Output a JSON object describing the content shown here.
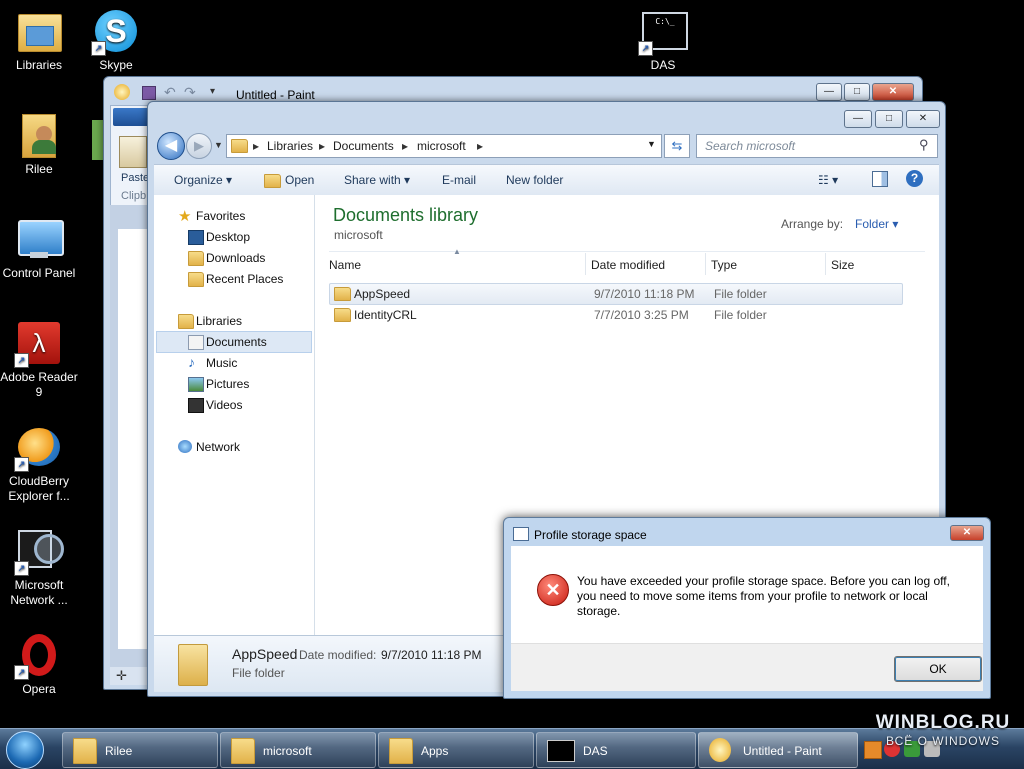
{
  "desktop": {
    "icons": [
      {
        "label": "Libraries"
      },
      {
        "label": "Skype"
      },
      {
        "label": "DAS"
      },
      {
        "label": "Rilee"
      },
      {
        "label": "Control Panel"
      },
      {
        "label": "Adobe Reader 9"
      },
      {
        "label": "CloudBerry Explorer f..."
      },
      {
        "label": "Microsoft Network ..."
      },
      {
        "label": "Opera"
      }
    ]
  },
  "paint": {
    "title": "Untitled - Paint",
    "paste_label": "Paste",
    "clipboard_label": "Clipb"
  },
  "explorer": {
    "breadcrumb": [
      "Libraries",
      "Documents",
      "microsoft"
    ],
    "search_placeholder": "Search microsoft",
    "toolbar": {
      "organize": "Organize",
      "open": "Open",
      "share_with": "Share with",
      "email": "E-mail",
      "new_folder": "New folder"
    },
    "nav": {
      "favorites": "Favorites",
      "desktop": "Desktop",
      "downloads": "Downloads",
      "recent_places": "Recent Places",
      "libraries": "Libraries",
      "documents": "Documents",
      "music": "Music",
      "pictures": "Pictures",
      "videos": "Videos",
      "network": "Network"
    },
    "library_title": "Documents library",
    "library_subtitle": "microsoft",
    "arrange_by_label": "Arrange by:",
    "arrange_by_value": "Folder",
    "columns": {
      "name": "Name",
      "date": "Date modified",
      "type": "Type",
      "size": "Size"
    },
    "files": [
      {
        "name": "AppSpeed",
        "date": "9/7/2010 11:18 PM",
        "type": "File folder"
      },
      {
        "name": "IdentityCRL",
        "date": "7/7/2010 3:25 PM",
        "type": "File folder"
      }
    ],
    "details": {
      "name": "AppSpeed",
      "date_label": "Date modified:",
      "date_value": "9/7/2010 11:18 PM",
      "type": "File folder"
    }
  },
  "dialog": {
    "title": "Profile storage space",
    "message": "You have exceeded your profile storage space. Before you can log off, you need to move some items from your profile to network or local storage.",
    "ok_label": "OK"
  },
  "taskbar": {
    "items": [
      {
        "label": "Rilee"
      },
      {
        "label": "microsoft"
      },
      {
        "label": "Apps"
      },
      {
        "label": "DAS"
      },
      {
        "label": "Untitled - Paint"
      }
    ]
  },
  "watermark": {
    "line1": "WINBLOG.RU",
    "line2": "ВСЁ О WINDOWS"
  }
}
